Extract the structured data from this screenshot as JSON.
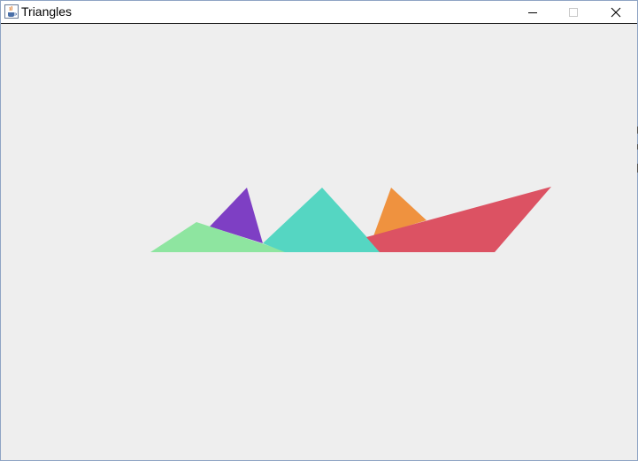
{
  "window": {
    "title": "Triangles",
    "icon": "java-cup-icon",
    "controls": {
      "minimize": "minimize-icon",
      "maximize": "maximize-icon",
      "close": "close-icon"
    }
  },
  "colors": {
    "titlebar_bg": "#ffffff",
    "canvas_bg": "#eeeeee",
    "light-green": "#8ee5a0",
    "purple": "#7e3fc4",
    "turquoise": "#55d6c2",
    "orange": "#ef923f",
    "crimson": "#dc5263"
  },
  "canvas": {
    "triangles": [
      {
        "name": "light-green-triangle",
        "color": "#8ee5a0"
      },
      {
        "name": "purple-triangle",
        "color": "#7e3fc4"
      },
      {
        "name": "turquoise-triangle",
        "color": "#55d6c2"
      },
      {
        "name": "orange-triangle",
        "color": "#ef923f"
      },
      {
        "name": "crimson-triangle",
        "color": "#dc5263"
      }
    ]
  }
}
